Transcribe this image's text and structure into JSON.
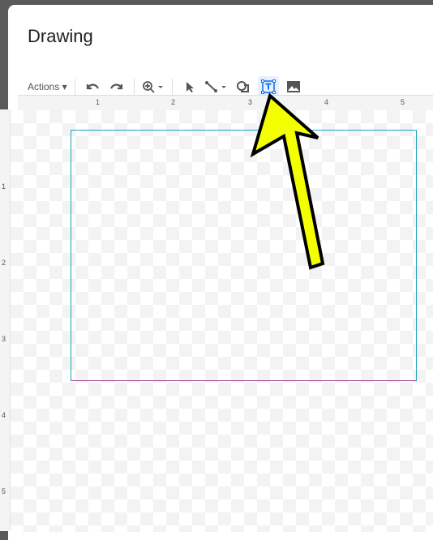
{
  "dialog": {
    "title": "Drawing"
  },
  "toolbar": {
    "actions_label": "Actions ▾",
    "tools": [
      "undo-icon",
      "redo-icon",
      "zoom-icon",
      "select-icon",
      "line-icon",
      "shape-icon",
      "text-box-icon",
      "image-icon"
    ],
    "selected": "text-box-icon",
    "accent": "#1a73e8"
  },
  "ruler": {
    "h_labels": [
      "1",
      "2",
      "3",
      "4",
      "5"
    ],
    "v_labels": [
      "1",
      "2",
      "3",
      "4",
      "5"
    ]
  },
  "annotation": {
    "arrow_color": "#f4ff00"
  }
}
